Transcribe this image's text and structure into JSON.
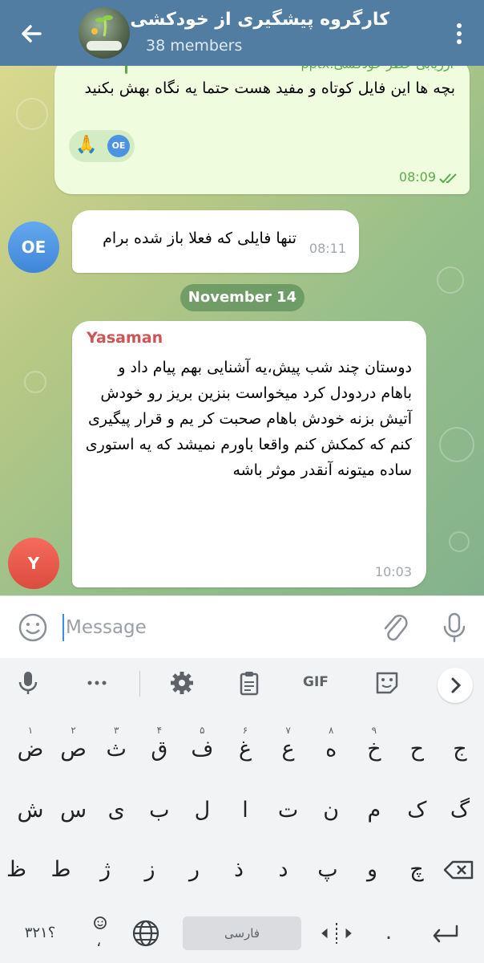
{
  "header": {
    "title": "کارگروه پیشگیری از خودکشی",
    "subtitle": "38 members",
    "back_icon": "arrow-back-icon",
    "menu_icon": "more-vert-icon",
    "bg_color": "#517da2"
  },
  "messages": {
    "m1": {
      "reply_text": "ارزیابی خطر خودکشی.pptx",
      "text": "بچه ها این فایل  کوتاه و مفید هست حتما یه نگاه بهش بکنید",
      "reaction_emoji": "🙏",
      "reaction_avatar": "OE",
      "time": "08:09"
    },
    "m2": {
      "avatar": "OE",
      "text": "تنها فایلی که فعلا باز شده برام",
      "time": "08:11"
    },
    "date_separator": "November 14",
    "m3": {
      "avatar": "Y",
      "sender": "Yasaman",
      "text": "دوستان چند شب پیش،یه آشنایی بهم پیام داد و باهام دردودل کرد میخواست بنزین بریز رو خودش آتیش بزنه خودش باهام صحبت کر یم و قرار پیگیری کنم که کمکش کنم واقعا باورم نمیشد که یه استوری ساده میتونه آنقدر موثر باشه",
      "time": "10:03"
    }
  },
  "input": {
    "placeholder": "Message",
    "emoji_icon": "emoji-smile-icon",
    "attach_icon": "paperclip-icon",
    "mic_icon": "microphone-icon"
  },
  "keyboard": {
    "toolbar": [
      "mic-icon",
      "more-icon",
      "settings-icon",
      "clipboard-icon",
      "GIF",
      "sticker-icon",
      "chevron-right-icon"
    ],
    "gif_label": "GIF",
    "row1": [
      "ج",
      "ح",
      "خ",
      "ه",
      "ع",
      "غ",
      "ف",
      "ق",
      "ث",
      "ص",
      "ض"
    ],
    "row1_hints": [
      "",
      "",
      "۹",
      "۸",
      "۷",
      "۶",
      "۵",
      "۴",
      "۳",
      "۲",
      "۱"
    ],
    "row2": [
      "گ",
      "ک",
      "م",
      "ن",
      "ت",
      "ا",
      "ل",
      "ب",
      "ی",
      "س",
      "ش"
    ],
    "row3": [
      "چ",
      "و",
      "پ",
      "د",
      "ذ",
      "ر",
      "ز",
      "ژ",
      "ط",
      "ظ"
    ],
    "symbols_label": "؟۳۲۱",
    "space_label": "فارسی",
    "period_label": ".",
    "comma_label": "،"
  }
}
